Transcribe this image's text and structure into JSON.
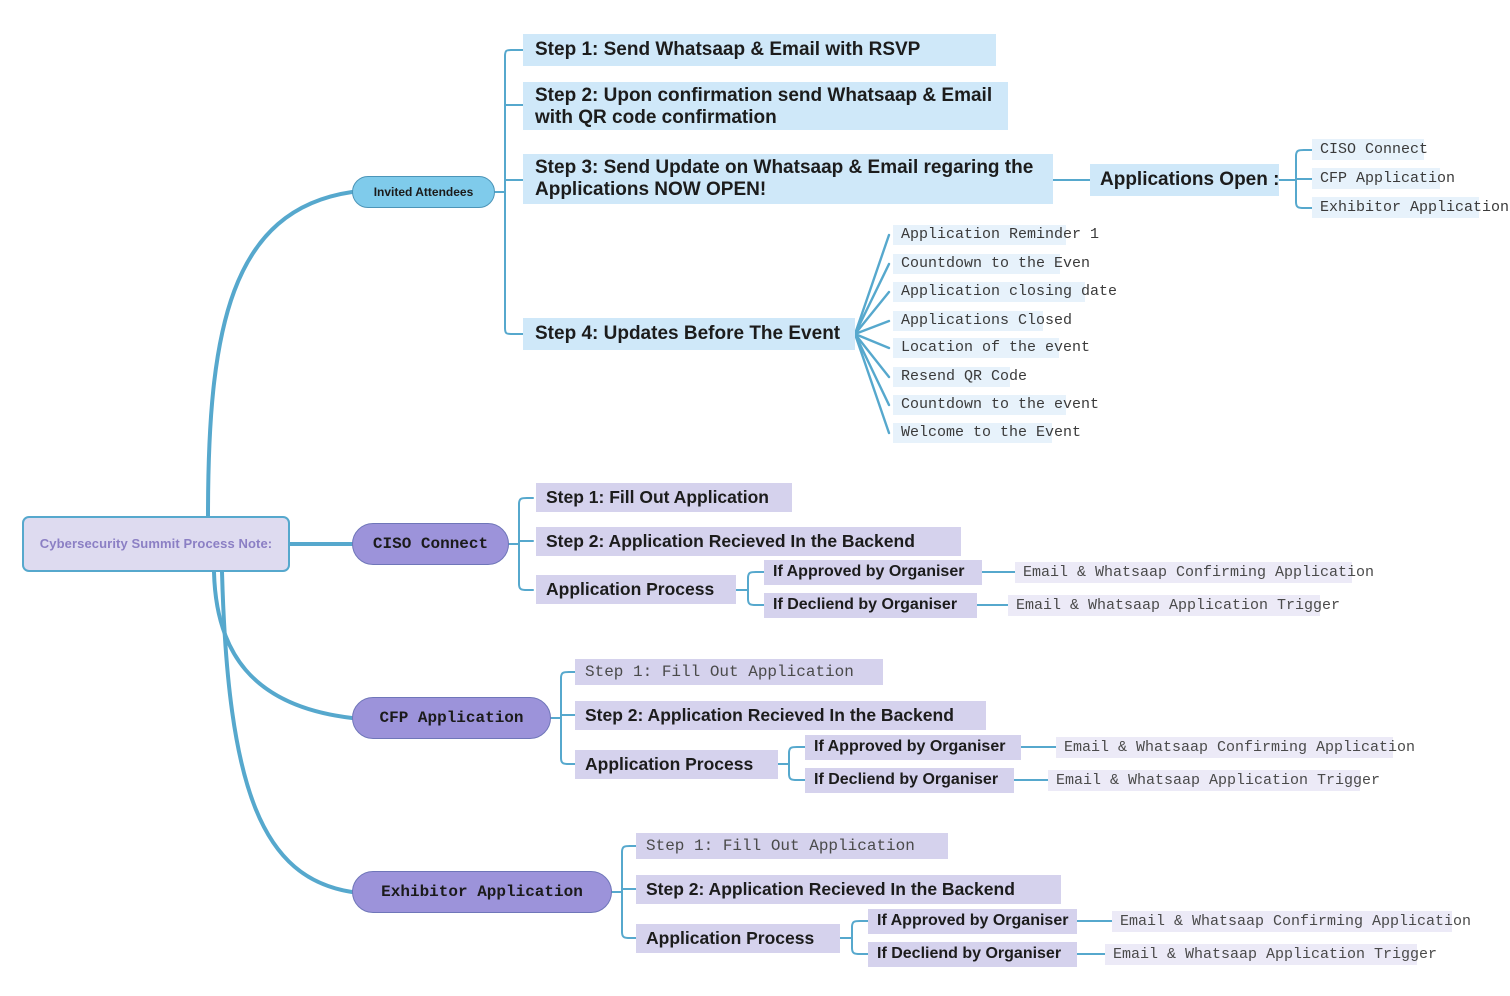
{
  "title": "Cybersecurity Summit Process Note mind map",
  "colors": {
    "edge": "#56a8cd",
    "root_fill": "#dedbf0",
    "root_text": "#8b7fc4",
    "pill_blue": "#7fcbeb",
    "pill_purple": "#9c93da",
    "box_blue": "#cfe8f9",
    "box_blue_light": "#e7f2fb",
    "box_lavender": "#d5d2ed",
    "box_lavender_light": "#eceaf7"
  },
  "root": {
    "label": "Cybersecurity Summit Process Note:"
  },
  "branches": [
    {
      "id": "invited-attendees",
      "label": "Invited Attendees",
      "steps": [
        {
          "id": "step-1",
          "label": "Step 1: Send Whatsaap & Email with RSVP"
        },
        {
          "id": "step-2",
          "label": "Step 2: Upon confirmation send Whatsaap & Email\nwith QR code confirmation"
        },
        {
          "id": "step-3",
          "label": "Step 3: Send Update on Whatsaap & Email regaring the\nApplications NOW OPEN!"
        },
        {
          "id": "step-4",
          "label": "Step 4: Updates Before The Event"
        }
      ],
      "applications_open": {
        "label": "Applications Open :",
        "items": [
          "CISO Connect",
          "CFP Application",
          "Exhibitor Application"
        ]
      },
      "updates": [
        "Application Reminder 1",
        "Countdown to the Even",
        "Application closing date",
        "Applications Closed",
        "Location of the event",
        "Resend QR Code",
        "Countdown to the event",
        "Welcome to the Event"
      ]
    },
    {
      "id": "ciso-connect",
      "label": "CISO Connect",
      "step1": "Step 1: Fill Out Application",
      "step2": "Step 2: Application Recieved In the Backend",
      "process_label": "Application Process",
      "approved": "If Approved by Organiser",
      "declined": "If Decliend by Organiser",
      "approved_action": "Email & Whatsaap Confirming Application",
      "declined_action": "Email & Whatsaap Application Trigger"
    },
    {
      "id": "cfp-application",
      "label": "CFP Application",
      "step1": "Step 1: Fill Out Application",
      "step2": "Step 2: Application Recieved In the Backend",
      "process_label": "Application Process",
      "approved": "If Approved by Organiser",
      "declined": "If Decliend by Organiser",
      "approved_action": "Email & Whatsaap Confirming Application",
      "declined_action": "Email & Whatsaap Application Trigger"
    },
    {
      "id": "exhibitor-application",
      "label": "Exhibitor Application",
      "step1": "Step 1: Fill Out Application",
      "step2": "Step 2: Application Recieved In the Backend",
      "process_label": "Application Process",
      "approved": "If Approved by Organiser",
      "declined": "If Decliend by Organiser",
      "approved_action": "Email & Whatsaap Confirming Application",
      "declined_action": "Email & Whatsaap Application Trigger"
    }
  ]
}
